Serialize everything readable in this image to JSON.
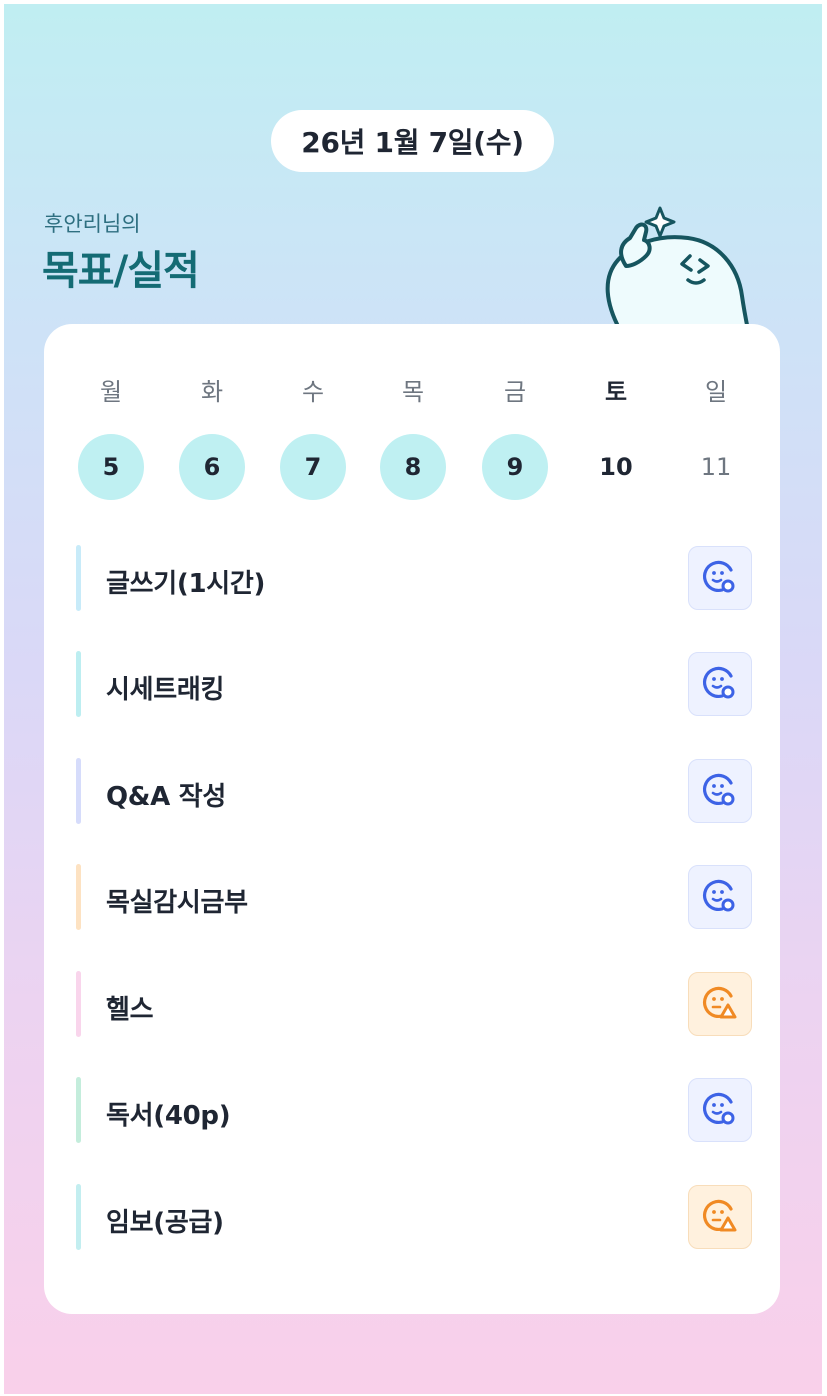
{
  "header": {
    "date": "26년 1월 7일(수)",
    "subtitle": "후안리님의",
    "title": "목표/실적"
  },
  "week": {
    "days": [
      {
        "name": "월",
        "num": "5",
        "done": true
      },
      {
        "name": "화",
        "num": "6",
        "done": true
      },
      {
        "name": "수",
        "num": "7",
        "done": true
      },
      {
        "name": "목",
        "num": "8",
        "done": true
      },
      {
        "name": "금",
        "num": "9",
        "done": true
      },
      {
        "name": "토",
        "num": "10",
        "done": false
      },
      {
        "name": "일",
        "num": "11",
        "done": false
      }
    ]
  },
  "goals": [
    {
      "label": "글쓰기(1시간)",
      "bar_color": "#c8ebf9",
      "status": "good"
    },
    {
      "label": "시세트래킹",
      "bar_color": "#bdeef1",
      "status": "good"
    },
    {
      "label": "Q&A 작성",
      "bar_color": "#d6dcfb",
      "status": "good"
    },
    {
      "label": "목실감시금부",
      "bar_color": "#fde2c2",
      "status": "good"
    },
    {
      "label": "헬스",
      "bar_color": "#f9d5ec",
      "status": "warn"
    },
    {
      "label": "독서(40p)",
      "bar_color": "#c4eddc",
      "status": "good"
    },
    {
      "label": "임보(공급)",
      "bar_color": "#c3eef0",
      "status": "warn"
    }
  ],
  "status_icons": {
    "good": {
      "icon": "smile-face-o-icon",
      "color": "#3d63e6"
    },
    "warn": {
      "icon": "neutral-face-triangle-icon",
      "color": "#f08a24"
    }
  }
}
